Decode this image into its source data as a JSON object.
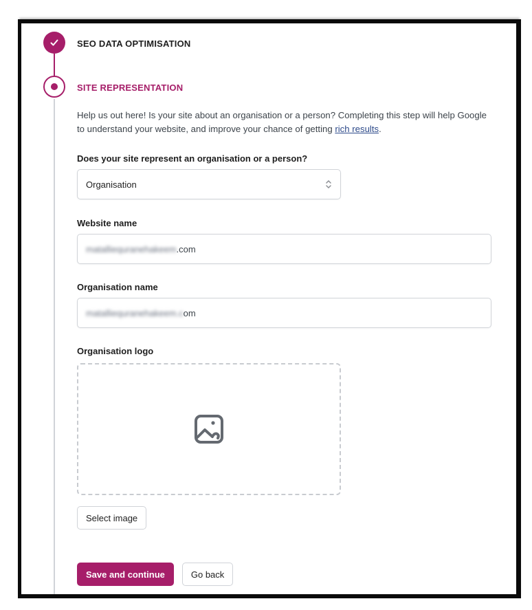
{
  "theme": {
    "accent": "#a61e69",
    "link": "#2d4a8a",
    "border": "#d0d3d8"
  },
  "steps": [
    {
      "title": "SEO DATA OPTIMISATION",
      "status": "complete",
      "icon": "check-icon"
    },
    {
      "title": "SITE REPRESENTATION",
      "status": "current",
      "icon": "dot-icon"
    }
  ],
  "site_representation": {
    "intro_text": "Help us out here! Is your site about an organisation or a person? Completing this step will help Google to understand your website, and improve your chance of getting ",
    "intro_link": "rich results",
    "intro_end": ".",
    "represent_label": "Does your site represent an organisation or a person?",
    "represent_value": "Organisation",
    "website_name_label": "Website name",
    "website_name_value_blurred": "matalliequranehakeem",
    "website_name_value_suffix": ".com",
    "org_name_label": "Organisation name",
    "org_name_value_blurred": "matalliequranehakeem.c",
    "org_name_value_suffix": "om",
    "org_logo_label": "Organisation logo",
    "logo_placeholder_icon": "image-icon",
    "select_image_label": "Select image",
    "save_label": "Save and continue",
    "back_label": "Go back"
  }
}
